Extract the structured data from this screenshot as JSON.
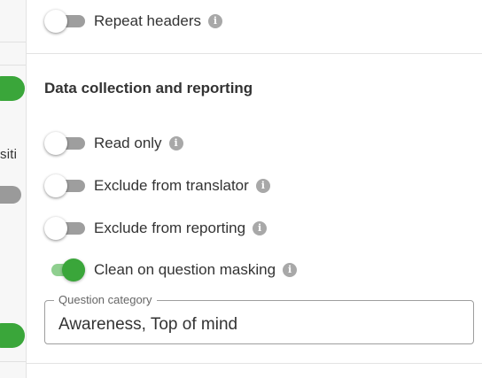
{
  "left_panel": {
    "truncated_label": "siti"
  },
  "options_top": [
    {
      "label": "Repeat headers",
      "on": false,
      "info_icon": "info-icon"
    }
  ],
  "section": {
    "title": "Data collection and reporting",
    "options": [
      {
        "label": "Read only",
        "on": false
      },
      {
        "label": "Exclude from translator",
        "on": false
      },
      {
        "label": "Exclude from reporting",
        "on": false
      },
      {
        "label": "Clean on question masking",
        "on": true
      }
    ],
    "category_field": {
      "legend": "Question category",
      "value": "Awareness, Top of mind"
    }
  },
  "colors": {
    "toggle_on": "#3aa63a",
    "toggle_on_track": "#8fcf8f",
    "toggle_off_track": "#9e9e9e",
    "info_icon": "#a8a8a8"
  }
}
